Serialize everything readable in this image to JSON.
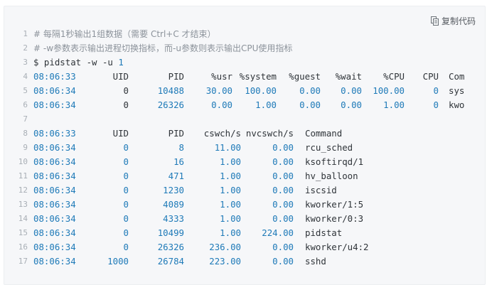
{
  "toolbar": {
    "copy_label": "复制代码",
    "copy_icon": "copy-icon"
  },
  "code": {
    "line_numbers": [
      "1",
      "2",
      "3",
      "4",
      "5",
      "6",
      "7",
      "8",
      "9",
      "10",
      "11",
      "12",
      "13",
      "14",
      "15",
      "16",
      "17"
    ],
    "comment1": "# 每隔1秒输出1组数据（需要 Ctrl+C 才结束）",
    "comment2": "# -w参数表示输出进程切换指标，而-u参数则表示输出CPU使用指标",
    "command": "$ pidstat -w -u 1",
    "header1": [
      "08:06:33",
      "UID",
      "PID",
      "%usr",
      "%system",
      "%guest",
      "%wait",
      "%CPU",
      "CPU",
      "Com"
    ],
    "rows1": [
      [
        "08:06:34",
        "0",
        "10488",
        "30.00",
        "100.00",
        "0.00",
        "0.00",
        "100.00",
        "0",
        "sys"
      ],
      [
        "08:06:34",
        "0",
        "26326",
        "0.00",
        "1.00",
        "0.00",
        "0.00",
        "1.00",
        "0",
        "kwo"
      ]
    ],
    "header2": [
      "08:06:33",
      "UID",
      "PID",
      "cswch/s",
      "nvcswch/s",
      "Command"
    ],
    "rows2": [
      [
        "08:06:34",
        "0",
        "8",
        "11.00",
        "0.00",
        "rcu_sched"
      ],
      [
        "08:06:34",
        "0",
        "16",
        "1.00",
        "0.00",
        "ksoftirqd/1"
      ],
      [
        "08:06:34",
        "0",
        "471",
        "1.00",
        "0.00",
        "hv_balloon"
      ],
      [
        "08:06:34",
        "0",
        "1230",
        "1.00",
        "0.00",
        "iscsid"
      ],
      [
        "08:06:34",
        "0",
        "4089",
        "1.00",
        "0.00",
        "kworker/1:5"
      ],
      [
        "08:06:34",
        "0",
        "4333",
        "1.00",
        "0.00",
        "kworker/0:3"
      ],
      [
        "08:06:34",
        "0",
        "10499",
        "1.00",
        "224.00",
        "pidstat"
      ],
      [
        "08:06:34",
        "0",
        "26326",
        "236.00",
        "0.00",
        "kworker/u4:2"
      ],
      [
        "08:06:34",
        "1000",
        "26784",
        "223.00",
        "0.00",
        "sshd"
      ]
    ]
  },
  "colors": {
    "number": "#1e7ab8",
    "comment": "#8c939b",
    "text": "#2f3439",
    "background": "#f6f7f9"
  }
}
